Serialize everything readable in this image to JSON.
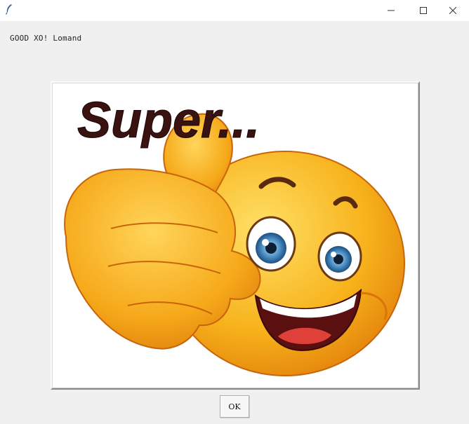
{
  "window": {
    "icon": "feather-icon",
    "controls": [
      "minimize-icon",
      "maximize-icon",
      "close-icon"
    ]
  },
  "dialog": {
    "message": "GOOD XO! Lomand",
    "image_caption": "Super...",
    "ok_label": "OK"
  },
  "colors": {
    "window_bg": "#f0f0f0",
    "titlebar_bg": "#ffffff",
    "emoji_yellow": "#f7b21b",
    "caption_color": "#3a1210"
  }
}
